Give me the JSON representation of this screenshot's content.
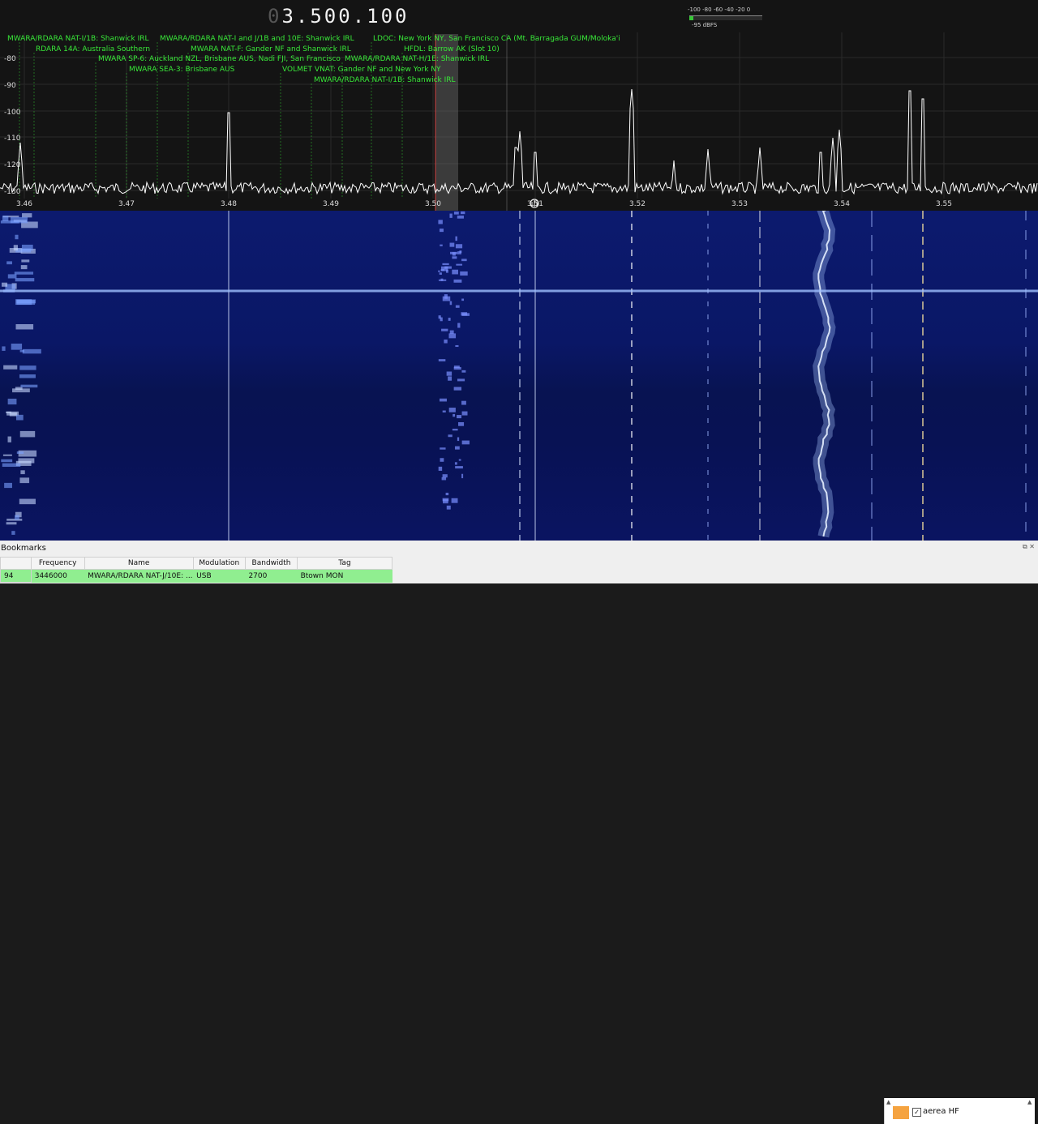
{
  "frequency": {
    "lead": "0",
    "main": "3.500.100"
  },
  "smeter": {
    "scale": "-100 -80 -60 -40 -20  0",
    "reading": "-95 dBFS",
    "level": 0.06
  },
  "spectrum": {
    "db_ticks": [
      "-80",
      "-90",
      "-100",
      "-110",
      "-120",
      "-130"
    ],
    "freq_ticks": [
      "3.46",
      "3.47",
      "3.48",
      "3.49",
      "3.50",
      "3.51",
      "3.52",
      "3.53",
      "3.54",
      "3.55"
    ],
    "bookmark_labels": [
      "MWARA/RDARA NAT-I/1B: Shanwick IRL",
      "RDARA 14A: Australia Southern",
      "MWARA SP-6: Auckland NZL, Brisbane AUS, Nadi FJI, San Francisco",
      "MWARA SEA-3: Brisbane AUS",
      "MWARA/RDARA NAT-I and J/1B and 10E: Shanwick IRL",
      "MWARA NAT-F: Gander NF and Shanwick IRL",
      "VOLMET VNAT: Gander NF and New York NY",
      "MWARA/RDARA NAT-I/1B: Shanwick IRL",
      "MWARA/RDARA NAT-H/1E: Shanwick IRL",
      "LDOC: New York NY, San Francisco CA (Mt. Barragada GUM/Moloka'i",
      "HFDL: Barrow AK (Slot 10)"
    ]
  },
  "bookmarks": {
    "title": "Bookmarks",
    "columns": [
      "Frequency",
      "Name",
      "Modulation",
      "Bandwidth",
      "Tag"
    ],
    "rows": [
      {
        "num": "94",
        "frequency": "3446000",
        "name": "MWARA/RDARA NAT-J/10E: ...",
        "modulation": "USB",
        "bandwidth": "2700",
        "tag": "Btown MON"
      }
    ]
  },
  "tags": {
    "item": "aerea HF",
    "checked": "✓",
    "color": "#f5a340"
  },
  "colors": {
    "label_green": "#38e838",
    "spectrum_bg": "#141414",
    "waterfall_blue": "#0a1766"
  }
}
